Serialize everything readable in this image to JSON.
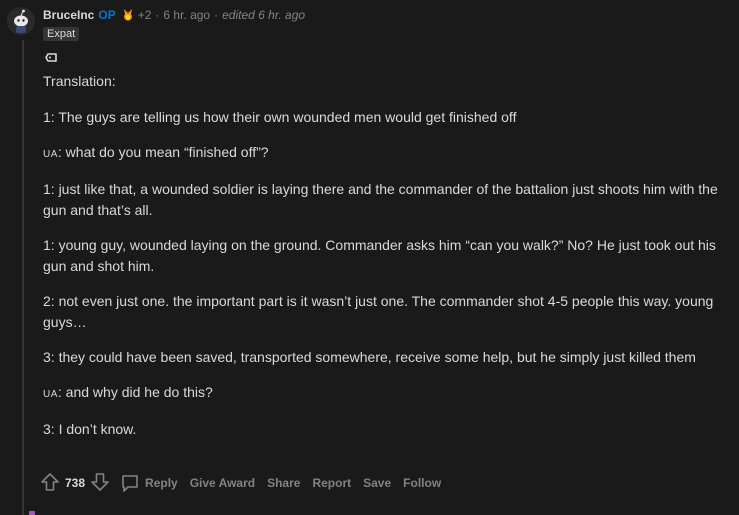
{
  "comment": {
    "author": "BruceInc",
    "op_label": "OP",
    "karma": "+2",
    "time": "6 hr. ago",
    "edited": "edited 6 hr. ago",
    "flair": "Expat",
    "translation_label": "Translation:",
    "lines": [
      {
        "speaker": "1",
        "text": ": The guys are telling us how their own wounded men would get finished off"
      },
      {
        "speaker": "UA",
        "text": ": what do you mean “finished off”?"
      },
      {
        "speaker": "1",
        "text": ": just like that, a wounded soldier is laying there and the commander of the battalion just shoots him with the gun and that’s all."
      },
      {
        "speaker": "1",
        "text": ": young guy, wounded laying on the ground. Commander asks him “can you walk?” No? He just took out his gun and shot him."
      },
      {
        "speaker": "2",
        "text": ": not even just one. the important part is it wasn’t just one. The commander shot 4-5 people this way. young guys…"
      },
      {
        "speaker": "3",
        "text": ": they could have been saved, transported somewhere, receive some help, but he simply just killed them"
      },
      {
        "speaker": "UA",
        "text": ": and why did he do this?"
      },
      {
        "speaker": "3",
        "text": ": I don’t know."
      }
    ]
  },
  "actions": {
    "vote_count": "738",
    "reply": "Reply",
    "give_award": "Give Award",
    "share": "Share",
    "report": "Report",
    "save": "Save",
    "follow": "Follow"
  },
  "icons": {
    "upvote": "upvote-arrow-icon",
    "downvote": "downvote-arrow-icon",
    "reply": "comment-bubble-icon",
    "award": "award-icon",
    "flag": "flag-icon"
  },
  "colors": {
    "background": "#1a1a1b",
    "text": "#d7dadc",
    "muted": "#818384",
    "op_blue": "#0079d3",
    "flair_bg": "#343536"
  }
}
